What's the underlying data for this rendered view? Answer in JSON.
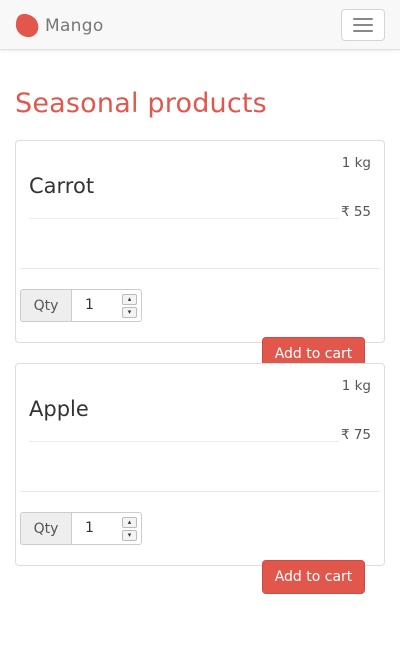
{
  "navbar": {
    "brand_name": "Mango",
    "menu_icon": "hamburger-icon",
    "logo_icon": "mango-logo-icon"
  },
  "page": {
    "title": "Seasonal products"
  },
  "products": [
    {
      "name": "Carrot",
      "weight": "1 kg",
      "price": "₹ 55",
      "qty_label": "Qty",
      "qty_value": "1",
      "add_label": "Add to cart"
    },
    {
      "name": "Apple",
      "weight": "1 kg",
      "price": "₹ 75",
      "qty_label": "Qty",
      "qty_value": "1",
      "add_label": "Add to cart"
    }
  ],
  "colors": {
    "accent": "#e2574c",
    "navbar_bg": "#f8f8f8",
    "brand_text": "#777777"
  }
}
